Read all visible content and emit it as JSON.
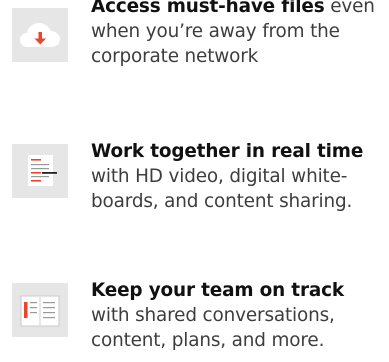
{
  "features": [
    {
      "icon": "cloud-download-icon",
      "headline": "Access must-have files",
      "body_lines": [
        "even",
        "when you’re away from the",
        "corporate network"
      ]
    },
    {
      "icon": "whiteboard-list-icon",
      "headline": "Work together in real time",
      "body_lines": [
        "with HD video, digital white-",
        "boards, and content sharing."
      ]
    },
    {
      "icon": "notebook-icon",
      "headline": "Keep your team on track",
      "body_lines": [
        "with shared conversations,",
        "content, plans, and more."
      ]
    }
  ],
  "colors": {
    "tile_background": "#e6e6e6",
    "accent_red": "#e8472a",
    "headline": "#111111",
    "body": "#3d3d3d"
  }
}
